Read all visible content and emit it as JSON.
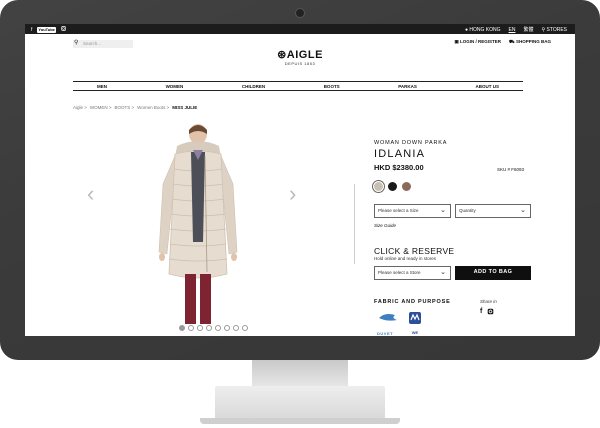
{
  "topbar": {
    "social": [
      "facebook-icon",
      "youtube-icon",
      "instagram-icon"
    ],
    "youtube_label": "YouTube",
    "region": "HONG KONG",
    "lang_en": "EN",
    "lang_zh": "繁體",
    "stores": "STORES"
  },
  "header": {
    "search_placeholder": "Search...",
    "logo_text": "AIGLE",
    "logo_sub": "DEPUIS 1853",
    "login": "LOGIN / REGISTER",
    "bag": "SHOPPING BAG"
  },
  "nav": [
    "MEN",
    "WOMEN",
    "CHILDREN",
    "BOOTS",
    "PARKAS",
    "ABOUT US"
  ],
  "breadcrumb": [
    "Aigle >",
    "WOMEN >",
    "BOOTS >",
    "Women Boots >",
    "MISS JULIE"
  ],
  "product": {
    "subtitle": "WOMAN DOWN PARKA",
    "name": "IDLANIA",
    "price": "HKD $2380.00",
    "sku": "SKU #  F6093",
    "swatches": [
      "#c9bfb3",
      "#1a1a1a",
      "#8b6a5b"
    ],
    "size_placeholder": "Please select a Size",
    "qty_placeholder": "Quantity",
    "size_guide": "Size Guide",
    "click_reserve": "CLICK & RESERVE",
    "click_reserve_sub": "Hold online and ready in stores",
    "store_placeholder": "Please select  a Store",
    "add_to_bag": "ADD TO BAG",
    "fabric_heading": "FABRIC AND PURPOSE",
    "share_on": "Share in",
    "badge_duvet": "DUVET",
    "badge_we": "WE"
  },
  "gallery": {
    "dot_count": 8,
    "active_index": 0
  }
}
